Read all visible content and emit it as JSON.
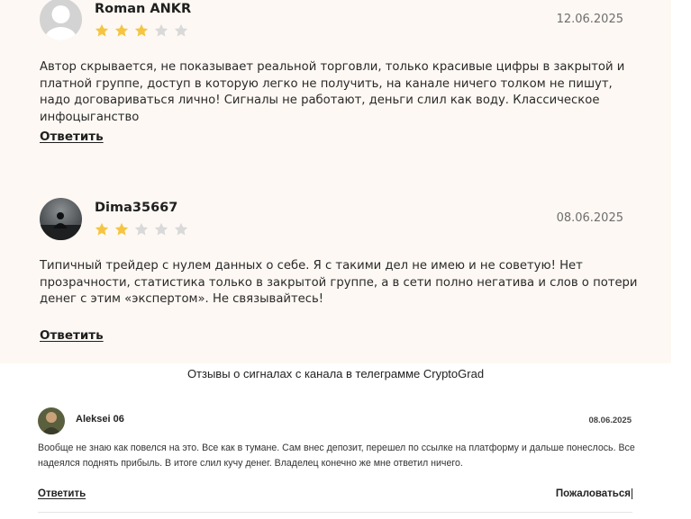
{
  "reviews": [
    {
      "author": "Roman ANKR",
      "date": "12.06.2025",
      "rating": 3,
      "max_rating": 5,
      "avatar": "default-user-avatar",
      "text": "Автор скрывается, не показывает реальной торговли, только красивые цифры в закрытой и платной группе, доступ в которую легко не получить, на канале ничего толком не пишут, надо договариваться лично! Сигналы не работают, деньги слил как воду. Классическое инфоцыганство",
      "reply_label": "Ответить"
    },
    {
      "author": "Dima35667",
      "date": "08.06.2025",
      "rating": 2,
      "max_rating": 5,
      "avatar": "photo-avatar",
      "text": "Типичный трейдер с нулем данных о себе. Я с такими дел не имею и не советую! Нет прозрачности, статистика только в закрытой группе, а в сети полно негатива и слов о потери денег с этим «экспертом». Не связывайтесь!",
      "reply_label": "Ответить"
    }
  ],
  "caption": "Отзывы о сигналах с канала в телеграмме CryptoGrad",
  "telegram_review": {
    "author": "Aleksei 06",
    "date": "08.06.2025",
    "avatar": "photo-avatar",
    "text": "Вообще не знаю как повелся на это. Все как в тумане. Сам внес депозит, перешел по ссылке на платформу и дальше понеслось. Все надеялся поднять прибыль. В итоге слил кучу денег. Владелец конечно же мне ответил ничего.",
    "reply_label": "Ответить",
    "report_label": "Пожаловаться"
  },
  "colors": {
    "panel_bg": "#fdf8f3",
    "star_filled": "#f5c542",
    "star_empty": "#d9d9d9"
  }
}
